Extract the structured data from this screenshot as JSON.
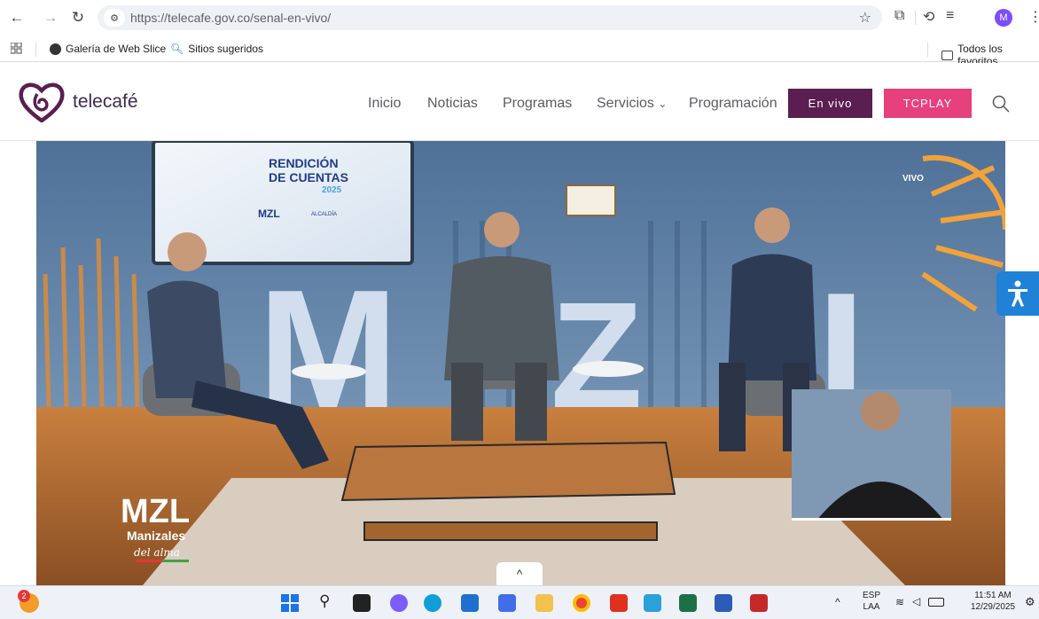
{
  "browser": {
    "url_host": "https://telecafe.gov.co",
    "url_path": "/senal-en-vivo/",
    "profile_initial": "M",
    "bookmarks": [
      {
        "label": "Galería de Web Slice"
      },
      {
        "label": "Sitios sugeridos"
      }
    ],
    "all_bookmarks": "Todos los favoritos"
  },
  "site": {
    "logo_text": "telecafé",
    "nav": [
      "Inicio",
      "Noticias",
      "Programas",
      "Servicios",
      "Programación"
    ],
    "servicios_caret": "⌄",
    "live_button": "En vivo",
    "tcplay_button": "TCPLAY",
    "brand_purple": "#5b1e50",
    "brand_pink": "#e6407d"
  },
  "video": {
    "screen_title_line1": "RENDICIÓN",
    "screen_title_line2": "DE CUENTAS",
    "screen_year": "2025",
    "screen_small": "MZL",
    "screen_alcaldia": "ALCALDÍA",
    "set_letters": [
      "M",
      "Z",
      "L"
    ],
    "bug_brand": "MZL",
    "bug_city": "Manizales",
    "bug_tagline": "del alma",
    "sun_label": "VIVO"
  },
  "collapse_arrow": "^",
  "taskbar": {
    "notification_count": "2",
    "lang_top": "ESP",
    "lang_bottom": "LAA",
    "time": "11:51 AM",
    "date": "12/29/2025"
  }
}
